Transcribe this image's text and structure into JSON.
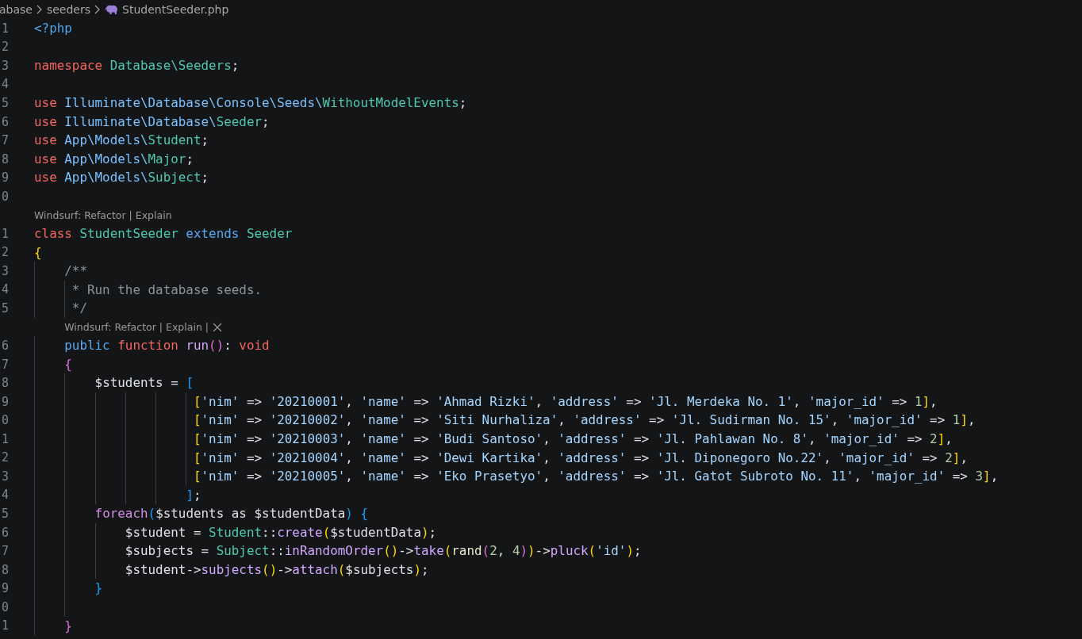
{
  "breadcrumb": [
    {
      "kind": "folder",
      "text": "abase"
    },
    {
      "kind": "folder",
      "text": "seeders"
    },
    {
      "kind": "file",
      "text": "StudentSeeder.php"
    }
  ],
  "lines": [
    {
      "kind": "code",
      "number": "1",
      "tokens": [
        {
          "kind": "tag",
          "text": "<?php"
        }
      ]
    },
    {
      "kind": "code",
      "number": "2"
    },
    {
      "kind": "code",
      "number": "3",
      "tokens": [
        {
          "kind": "kw",
          "text": "namespace "
        },
        {
          "kind": "type",
          "text": "Database\\Seeders"
        },
        {
          "kind": "plain",
          "text": ";"
        }
      ]
    },
    {
      "kind": "code",
      "number": "4"
    },
    {
      "kind": "code",
      "number": "5",
      "tokens": [
        {
          "kind": "kw",
          "text": "use "
        },
        {
          "kind": "ns",
          "text": "Illuminate\\Database\\Console\\Seeds\\"
        },
        {
          "kind": "type",
          "text": "WithoutModelEvents"
        },
        {
          "kind": "plain",
          "text": ";"
        }
      ]
    },
    {
      "kind": "code",
      "number": "6",
      "tokens": [
        {
          "kind": "kw",
          "text": "use "
        },
        {
          "kind": "ns",
          "text": "Illuminate\\Database\\"
        },
        {
          "kind": "type",
          "text": "Seeder"
        },
        {
          "kind": "plain",
          "text": ";"
        }
      ]
    },
    {
      "kind": "code",
      "number": "7",
      "tokens": [
        {
          "kind": "kw",
          "text": "use "
        },
        {
          "kind": "ns",
          "text": "App\\Models\\"
        },
        {
          "kind": "type",
          "text": "Student"
        },
        {
          "kind": "plain",
          "text": ";"
        }
      ]
    },
    {
      "kind": "code",
      "number": "8",
      "tokens": [
        {
          "kind": "kw",
          "text": "use "
        },
        {
          "kind": "ns",
          "text": "App\\Models\\"
        },
        {
          "kind": "type",
          "text": "Major"
        },
        {
          "kind": "plain",
          "text": ";"
        }
      ]
    },
    {
      "kind": "code",
      "number": "9",
      "tokens": [
        {
          "kind": "kw",
          "text": "use "
        },
        {
          "kind": "ns",
          "text": "App\\Models\\"
        },
        {
          "kind": "type",
          "text": "Subject"
        },
        {
          "kind": "plain",
          "text": ";"
        }
      ]
    },
    {
      "kind": "code",
      "number": "0"
    },
    {
      "kind": "codelens",
      "closable": false,
      "items": [
        {
          "kind": "action",
          "text": "Windsurf: Refactor"
        },
        {
          "kind": "separator",
          "text": "|"
        },
        {
          "kind": "action",
          "text": "Explain"
        }
      ]
    },
    {
      "kind": "code",
      "number": "1",
      "tokens": [
        {
          "kind": "kw",
          "text": "class "
        },
        {
          "kind": "type",
          "text": "StudentSeeder "
        },
        {
          "kind": "storage",
          "text": "extends "
        },
        {
          "kind": "type",
          "text": "Seeder"
        }
      ]
    },
    {
      "kind": "code",
      "number": "2",
      "tokens": [
        {
          "kind": "b1",
          "text": "{"
        }
      ]
    },
    {
      "kind": "code",
      "number": "3",
      "tokens": [
        {
          "kind": "cmt",
          "text": "    /**"
        }
      ]
    },
    {
      "kind": "code",
      "number": "4",
      "tokens": [
        {
          "kind": "cmt",
          "text": "     * Run the database seeds."
        }
      ]
    },
    {
      "kind": "code",
      "number": "5",
      "tokens": [
        {
          "kind": "cmt",
          "text": "     */"
        }
      ]
    },
    {
      "kind": "codelens",
      "closable": true,
      "items": [
        {
          "kind": "action",
          "text": "Windsurf: Refactor"
        },
        {
          "kind": "separator",
          "text": "|"
        },
        {
          "kind": "action",
          "text": "Explain"
        },
        {
          "kind": "separator",
          "text": "|"
        }
      ]
    },
    {
      "kind": "code",
      "number": "6",
      "tokens": [
        {
          "kind": "storage",
          "text": "    public "
        },
        {
          "kind": "kw",
          "text": "function "
        },
        {
          "kind": "fn",
          "text": "run"
        },
        {
          "kind": "b2",
          "text": "()"
        },
        {
          "kind": "plain",
          "text": ": "
        },
        {
          "kind": "kw",
          "text": "void"
        }
      ]
    },
    {
      "kind": "code",
      "number": "7",
      "tokens": [
        {
          "kind": "b2",
          "text": "    {"
        }
      ]
    },
    {
      "kind": "code",
      "number": "8",
      "tokens": [
        {
          "kind": "plain",
          "text": "        $students = "
        },
        {
          "kind": "b3",
          "text": "["
        }
      ]
    },
    {
      "kind": "code",
      "number": "9",
      "tokens": [
        {
          "kind": "b1",
          "text": "                     ["
        },
        {
          "kind": "str",
          "text": "'nim'"
        },
        {
          "kind": "plain",
          "text": " => "
        },
        {
          "kind": "str",
          "text": "'20210001'"
        },
        {
          "kind": "plain",
          "text": ", "
        },
        {
          "kind": "str",
          "text": "'name'"
        },
        {
          "kind": "plain",
          "text": " => "
        },
        {
          "kind": "str",
          "text": "'Ahmad Rizki'"
        },
        {
          "kind": "plain",
          "text": ", "
        },
        {
          "kind": "str",
          "text": "'address'"
        },
        {
          "kind": "plain",
          "text": " => "
        },
        {
          "kind": "str",
          "text": "'Jl. Merdeka No. 1'"
        },
        {
          "kind": "plain",
          "text": ", "
        },
        {
          "kind": "str",
          "text": "'major_id'"
        },
        {
          "kind": "plain",
          "text": " => "
        },
        {
          "kind": "num",
          "text": "1"
        },
        {
          "kind": "b1",
          "text": "]"
        },
        {
          "kind": "plain",
          "text": ","
        }
      ]
    },
    {
      "kind": "code",
      "number": "0",
      "tokens": [
        {
          "kind": "b1",
          "text": "                     ["
        },
        {
          "kind": "str",
          "text": "'nim'"
        },
        {
          "kind": "plain",
          "text": " => "
        },
        {
          "kind": "str",
          "text": "'20210002'"
        },
        {
          "kind": "plain",
          "text": ", "
        },
        {
          "kind": "str",
          "text": "'name'"
        },
        {
          "kind": "plain",
          "text": " => "
        },
        {
          "kind": "str",
          "text": "'Siti Nurhaliza'"
        },
        {
          "kind": "plain",
          "text": ", "
        },
        {
          "kind": "str",
          "text": "'address'"
        },
        {
          "kind": "plain",
          "text": " => "
        },
        {
          "kind": "str",
          "text": "'Jl. Sudirman No. 15'"
        },
        {
          "kind": "plain",
          "text": ", "
        },
        {
          "kind": "str",
          "text": "'major_id'"
        },
        {
          "kind": "plain",
          "text": " => "
        },
        {
          "kind": "num",
          "text": "1"
        },
        {
          "kind": "b1",
          "text": "]"
        },
        {
          "kind": "plain",
          "text": ","
        }
      ]
    },
    {
      "kind": "code",
      "number": "1",
      "tokens": [
        {
          "kind": "b1",
          "text": "                     ["
        },
        {
          "kind": "str",
          "text": "'nim'"
        },
        {
          "kind": "plain",
          "text": " => "
        },
        {
          "kind": "str",
          "text": "'20210003'"
        },
        {
          "kind": "plain",
          "text": ", "
        },
        {
          "kind": "str",
          "text": "'name'"
        },
        {
          "kind": "plain",
          "text": " => "
        },
        {
          "kind": "str",
          "text": "'Budi Santoso'"
        },
        {
          "kind": "plain",
          "text": ", "
        },
        {
          "kind": "str",
          "text": "'address'"
        },
        {
          "kind": "plain",
          "text": " => "
        },
        {
          "kind": "str",
          "text": "'Jl. Pahlawan No. 8'"
        },
        {
          "kind": "plain",
          "text": ", "
        },
        {
          "kind": "str",
          "text": "'major_id'"
        },
        {
          "kind": "plain",
          "text": " => "
        },
        {
          "kind": "num",
          "text": "2"
        },
        {
          "kind": "b1",
          "text": "]"
        },
        {
          "kind": "plain",
          "text": ","
        }
      ]
    },
    {
      "kind": "code",
      "number": "2",
      "tokens": [
        {
          "kind": "b1",
          "text": "                     ["
        },
        {
          "kind": "str",
          "text": "'nim'"
        },
        {
          "kind": "plain",
          "text": " => "
        },
        {
          "kind": "str",
          "text": "'20210004'"
        },
        {
          "kind": "plain",
          "text": ", "
        },
        {
          "kind": "str",
          "text": "'name'"
        },
        {
          "kind": "plain",
          "text": " => "
        },
        {
          "kind": "str",
          "text": "'Dewi Kartika'"
        },
        {
          "kind": "plain",
          "text": ", "
        },
        {
          "kind": "str",
          "text": "'address'"
        },
        {
          "kind": "plain",
          "text": " => "
        },
        {
          "kind": "str",
          "text": "'Jl. Diponegoro No.22'"
        },
        {
          "kind": "plain",
          "text": ", "
        },
        {
          "kind": "str",
          "text": "'major_id'"
        },
        {
          "kind": "plain",
          "text": " => "
        },
        {
          "kind": "num",
          "text": "2"
        },
        {
          "kind": "b1",
          "text": "]"
        },
        {
          "kind": "plain",
          "text": ","
        }
      ]
    },
    {
      "kind": "code",
      "number": "3",
      "tokens": [
        {
          "kind": "b1",
          "text": "                     ["
        },
        {
          "kind": "str",
          "text": "'nim'"
        },
        {
          "kind": "plain",
          "text": " => "
        },
        {
          "kind": "str",
          "text": "'20210005'"
        },
        {
          "kind": "plain",
          "text": ", "
        },
        {
          "kind": "str",
          "text": "'name'"
        },
        {
          "kind": "plain",
          "text": " => "
        },
        {
          "kind": "str",
          "text": "'Eko Prasetyo'"
        },
        {
          "kind": "plain",
          "text": ", "
        },
        {
          "kind": "str",
          "text": "'address'"
        },
        {
          "kind": "plain",
          "text": " => "
        },
        {
          "kind": "str",
          "text": "'Jl. Gatot Subroto No. 11'"
        },
        {
          "kind": "plain",
          "text": ", "
        },
        {
          "kind": "str",
          "text": "'major_id'"
        },
        {
          "kind": "plain",
          "text": " => "
        },
        {
          "kind": "num",
          "text": "3"
        },
        {
          "kind": "b1",
          "text": "]"
        },
        {
          "kind": "plain",
          "text": ","
        }
      ]
    },
    {
      "kind": "code",
      "number": "4",
      "tokens": [
        {
          "kind": "b3",
          "text": "                    ]"
        },
        {
          "kind": "plain",
          "text": ";"
        }
      ]
    },
    {
      "kind": "code",
      "number": "5",
      "tokens": [
        {
          "kind": "loop",
          "text": "        foreach"
        },
        {
          "kind": "b3",
          "text": "("
        },
        {
          "kind": "plain",
          "text": "$students as $studentData"
        },
        {
          "kind": "b3",
          "text": ") {"
        }
      ]
    },
    {
      "kind": "code",
      "number": "6",
      "tokens": [
        {
          "kind": "plain",
          "text": "            $student = "
        },
        {
          "kind": "type",
          "text": "Student"
        },
        {
          "kind": "plain",
          "text": "::"
        },
        {
          "kind": "fn",
          "text": "create"
        },
        {
          "kind": "b1",
          "text": "("
        },
        {
          "kind": "plain",
          "text": "$studentData"
        },
        {
          "kind": "b1",
          "text": ")"
        },
        {
          "kind": "plain",
          "text": ";"
        }
      ]
    },
    {
      "kind": "code",
      "number": "7",
      "tokens": [
        {
          "kind": "plain",
          "text": "            $subjects = "
        },
        {
          "kind": "type",
          "text": "Subject"
        },
        {
          "kind": "plain",
          "text": "::"
        },
        {
          "kind": "fn",
          "text": "inRandomOrder"
        },
        {
          "kind": "b1",
          "text": "()"
        },
        {
          "kind": "plain",
          "text": "->"
        },
        {
          "kind": "fn",
          "text": "take"
        },
        {
          "kind": "b1",
          "text": "("
        },
        {
          "kind": "builtin",
          "text": "rand"
        },
        {
          "kind": "b2",
          "text": "("
        },
        {
          "kind": "num",
          "text": "2"
        },
        {
          "kind": "plain",
          "text": ", "
        },
        {
          "kind": "num",
          "text": "4"
        },
        {
          "kind": "b2",
          "text": ")"
        },
        {
          "kind": "b1",
          "text": ")"
        },
        {
          "kind": "plain",
          "text": "->"
        },
        {
          "kind": "fn",
          "text": "pluck"
        },
        {
          "kind": "b1",
          "text": "("
        },
        {
          "kind": "str",
          "text": "'id'"
        },
        {
          "kind": "b1",
          "text": ")"
        },
        {
          "kind": "plain",
          "text": ";"
        }
      ]
    },
    {
      "kind": "code",
      "number": "8",
      "tokens": [
        {
          "kind": "plain",
          "text": "            $student->"
        },
        {
          "kind": "fn",
          "text": "subjects"
        },
        {
          "kind": "b1",
          "text": "()"
        },
        {
          "kind": "plain",
          "text": "->"
        },
        {
          "kind": "fn",
          "text": "attach"
        },
        {
          "kind": "b1",
          "text": "("
        },
        {
          "kind": "plain",
          "text": "$subjects"
        },
        {
          "kind": "b1",
          "text": ")"
        },
        {
          "kind": "plain",
          "text": ";"
        }
      ]
    },
    {
      "kind": "code",
      "number": "9",
      "tokens": [
        {
          "kind": "b3",
          "text": "        }"
        }
      ]
    },
    {
      "kind": "code",
      "number": "0"
    },
    {
      "kind": "code",
      "number": "1",
      "tokens": [
        {
          "kind": "b2",
          "text": "    }"
        }
      ]
    }
  ]
}
